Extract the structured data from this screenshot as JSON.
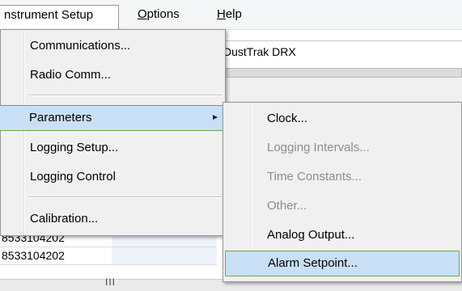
{
  "menubar": {
    "items": [
      {
        "label": "nstrument Setup",
        "underline": ""
      },
      {
        "label": "Options",
        "underline": "O"
      },
      {
        "label": "Help",
        "underline": "H"
      }
    ]
  },
  "background": {
    "instrument_name": "DustTrak DRX",
    "rows": [
      "8533104202",
      "8533104202",
      "8533104202"
    ],
    "scroll_grip": "III"
  },
  "instrument_menu": {
    "items": [
      {
        "label": "Communications...",
        "enabled": true
      },
      {
        "label": "Radio Comm...",
        "enabled": true
      },
      {
        "label": "Parameters",
        "enabled": true,
        "submenu": true,
        "highlighted": true
      },
      {
        "label": "Logging Setup...",
        "enabled": true
      },
      {
        "label": "Logging Control",
        "enabled": true
      },
      {
        "label": "Calibration...",
        "enabled": true
      }
    ],
    "submenu_arrow": "►"
  },
  "parameters_menu": {
    "items": [
      {
        "label": "Clock...",
        "enabled": true
      },
      {
        "label": "Logging Intervals...",
        "enabled": false
      },
      {
        "label": "Time Constants...",
        "enabled": false
      },
      {
        "label": "Other...",
        "enabled": false
      },
      {
        "label": "Analog Output...",
        "enabled": true
      },
      {
        "label": "Alarm Setpoint...",
        "enabled": true,
        "highlighted": true
      }
    ]
  },
  "colors": {
    "highlight_fill": "#c9dff6",
    "highlight_border": "#6fa848",
    "disabled_text": "#8d8d8d"
  }
}
